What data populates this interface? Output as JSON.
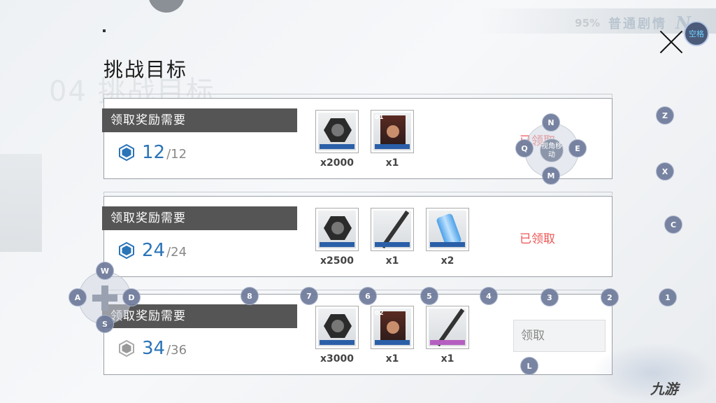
{
  "header": {
    "title": "挑战目标",
    "progress_pct": "95",
    "pct_sign": "%",
    "mode_label": "普通剧情",
    "mode_mark": "N",
    "space_key_label": "空格",
    "ghost_text": "04 挑战目标"
  },
  "cards": [
    {
      "requirement_label": "领取奖励需要",
      "progress_current": "12",
      "progress_total": "/12",
      "hex_color": "#2b74b8",
      "rewards": [
        {
          "icon": "nut-icon",
          "qty": "x2000"
        },
        {
          "icon": "character-card-icon",
          "card_no": "01",
          "qty": "x1"
        }
      ],
      "status": "已领取"
    },
    {
      "requirement_label": "领取奖励需要",
      "progress_current": "24",
      "progress_total": "/24",
      "hex_color": "#2b74b8",
      "rewards": [
        {
          "icon": "nut-icon",
          "qty": "x2500"
        },
        {
          "icon": "rod-icon",
          "qty": "x1"
        },
        {
          "icon": "canister-icon",
          "qty": "x2"
        }
      ],
      "status": "已领取"
    },
    {
      "requirement_label": "领取奖励需要",
      "progress_current": "34",
      "progress_total": "/36",
      "hex_color": "#999999",
      "rewards": [
        {
          "icon": "nut-icon",
          "qty": "x3000"
        },
        {
          "icon": "character-card-icon",
          "card_no": "02",
          "qty": "x1"
        },
        {
          "icon": "rod-icon",
          "qty": "x1"
        }
      ],
      "claim_label": "领取"
    }
  ],
  "keymap": {
    "camera_pad": {
      "top": "N",
      "left": "Q",
      "right": "E",
      "bottom": "M",
      "center": "视角移动"
    },
    "move_pad": {
      "top": "W",
      "left": "A",
      "right": "D",
      "bottom": "S"
    },
    "right_keys": [
      "Z",
      "X",
      "C",
      "1",
      "L"
    ],
    "number_keys": [
      "8",
      "7",
      "6",
      "5",
      "4",
      "3",
      "2"
    ]
  },
  "watermark": "九游"
}
